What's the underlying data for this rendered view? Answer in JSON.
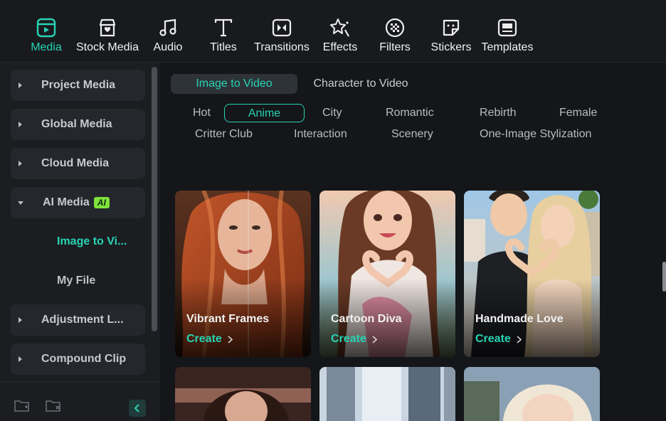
{
  "toolbar": {
    "items": [
      {
        "label": "Media",
        "icon": "media-icon",
        "active": true
      },
      {
        "label": "Stock Media",
        "icon": "stock-media-icon"
      },
      {
        "label": "Audio",
        "icon": "music-note-icon"
      },
      {
        "label": "Titles",
        "icon": "titles-icon"
      },
      {
        "label": "Transitions",
        "icon": "transitions-icon"
      },
      {
        "label": "Effects",
        "icon": "effects-icon"
      },
      {
        "label": "Filters",
        "icon": "filters-icon"
      },
      {
        "label": "Stickers",
        "icon": "stickers-icon"
      },
      {
        "label": "Templates",
        "icon": "templates-icon"
      }
    ]
  },
  "sidebar": {
    "items": [
      {
        "label": "Project Media"
      },
      {
        "label": "Global Media"
      },
      {
        "label": "Cloud Media"
      },
      {
        "label": "AI Media",
        "badge": "AI",
        "expanded": true
      },
      {
        "label": "Adjustment L..."
      },
      {
        "label": "Compound Clip"
      }
    ],
    "sub_items": [
      {
        "label": "Image to Vi...",
        "active": true
      },
      {
        "label": "My File"
      }
    ]
  },
  "main": {
    "segments": [
      {
        "label": "Image to Video",
        "active": true
      },
      {
        "label": "Character to Video"
      }
    ],
    "chips_row1": [
      "Hot",
      "Anime",
      "City",
      "Romantic",
      "Rebirth",
      "Female"
    ],
    "chips_row2": [
      "Critter Club",
      "Interaction",
      "Scenery",
      "One-Image Stylization"
    ],
    "active_chip": "Anime",
    "cards": [
      {
        "title": "Vibrant Frames",
        "action": "Create"
      },
      {
        "title": "Cartoon Diva",
        "action": "Create"
      },
      {
        "title": "Handmade Love",
        "action": "Create"
      }
    ]
  },
  "colors": {
    "accent": "#27d4b3",
    "badge": "#7ee33a",
    "background": "#141619"
  }
}
